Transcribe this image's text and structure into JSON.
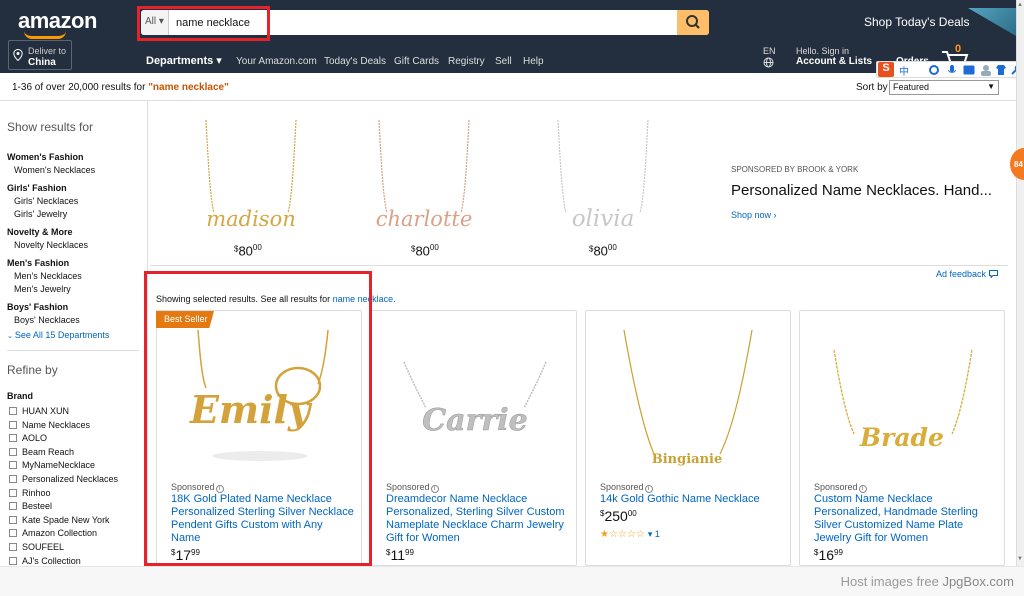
{
  "header": {
    "logo": "amazon",
    "deliver_line1": "Deliver to",
    "deliver_line2": "China",
    "search_category": "All ▾",
    "search_value": "name necklace",
    "deals_banner": "Shop Today's Deals"
  },
  "nav": {
    "departments": "Departments ▾",
    "links": [
      "Your Amazon.com",
      "Today's Deals",
      "Gift Cards",
      "Registry",
      "Sell",
      "Help"
    ],
    "lang_code": "EN",
    "account_line1": "Hello. Sign in",
    "account_line2": "Account & Lists",
    "orders": "Orders",
    "cart_count": "0"
  },
  "ime": {
    "logo": "S",
    "mode": "中"
  },
  "results": {
    "summary_prefix": "1-36 of over 20,000 results for ",
    "query": "\"name necklace\"",
    "sort_label": "Sort by",
    "sort_value": "Featured"
  },
  "sidebar": {
    "show_results_for": "Show results for",
    "categories": [
      {
        "name": "Women's Fashion",
        "subs": [
          "Women's Necklaces"
        ]
      },
      {
        "name": "Girls' Fashion",
        "subs": [
          "Girls' Necklaces",
          "Girls' Jewelry"
        ]
      },
      {
        "name": "Novelty & More",
        "subs": [
          "Novelty Necklaces"
        ]
      },
      {
        "name": "Men's Fashion",
        "subs": [
          "Men's Necklaces",
          "Men's Jewelry"
        ]
      },
      {
        "name": "Boys' Fashion",
        "subs": [
          "Boys' Necklaces"
        ]
      }
    ],
    "see_all": "See All 15 Departments",
    "refine_by": "Refine by",
    "brand_heading": "Brand",
    "brands": [
      "HUAN XUN",
      "Name Necklaces",
      "AOLO",
      "Beam Reach",
      "MyNameNecklace",
      "Personalized Necklaces",
      "Rinhoo",
      "Besteel",
      "Kate Spade New York",
      "Amazon Collection",
      "SOUFEEL",
      "AJ's Collection"
    ]
  },
  "banner": {
    "items": [
      {
        "name": "madison",
        "color": "#d4a645",
        "price_cur": "$",
        "price_whole": "80",
        "price_cents": "00"
      },
      {
        "name": "charlotte",
        "color": "#d9a08a",
        "price_cur": "$",
        "price_whole": "80",
        "price_cents": "00"
      },
      {
        "name": "olivia",
        "color": "#c8c8c8",
        "price_cur": "$",
        "price_whole": "80",
        "price_cents": "00"
      }
    ],
    "sponsor": "SPONSORED BY BROOK & YORK",
    "title": "Personalized Name Necklaces. Hand...",
    "shop_now": "Shop now ›",
    "ad_feedback": "Ad feedback"
  },
  "showing": {
    "text": "Showing selected results. See all results for ",
    "link": "name necklace."
  },
  "products": [
    {
      "badge": "Best Seller",
      "name": "Emily",
      "color": "#d4a23a",
      "sponsored": "Sponsored",
      "title": "18K Gold Plated Name Necklace Personalized Sterling Silver Necklace Pendent Gifts Custom with Any Name",
      "price_cur": "$",
      "price_whole": "17",
      "price_cents": "99"
    },
    {
      "name": "Carrie",
      "color": "#bfbfbf",
      "sponsored": "Sponsored",
      "title": "Dreamdecor Name Necklace Personalized, Sterling Silver Custom Nameplate Necklace Charm Jewelry Gift for Women",
      "price_cur": "$",
      "price_whole": "11",
      "price_cents": "99"
    },
    {
      "name": "Bingianie",
      "color": "#c9a233",
      "sponsored": "Sponsored",
      "title": "14k Gold Gothic Name Necklace",
      "price_cur": "$",
      "price_whole": "250",
      "price_cents": "00",
      "stars": "★☆☆☆☆",
      "rating_count": "▾ 1"
    },
    {
      "name": "Brade",
      "color": "#d9ad3a",
      "sponsored": "Sponsored",
      "title": "Custom Name Necklace Personalized, Handmade Sterling Silver Customized Name Plate Jewelry Gift for Women",
      "price_cur": "$",
      "price_whole": "16",
      "price_cents": "99"
    }
  ],
  "side_badge": "84",
  "footer": {
    "watermark_prefix": "Host images free ",
    "watermark_brand": "JpgBox.com"
  }
}
